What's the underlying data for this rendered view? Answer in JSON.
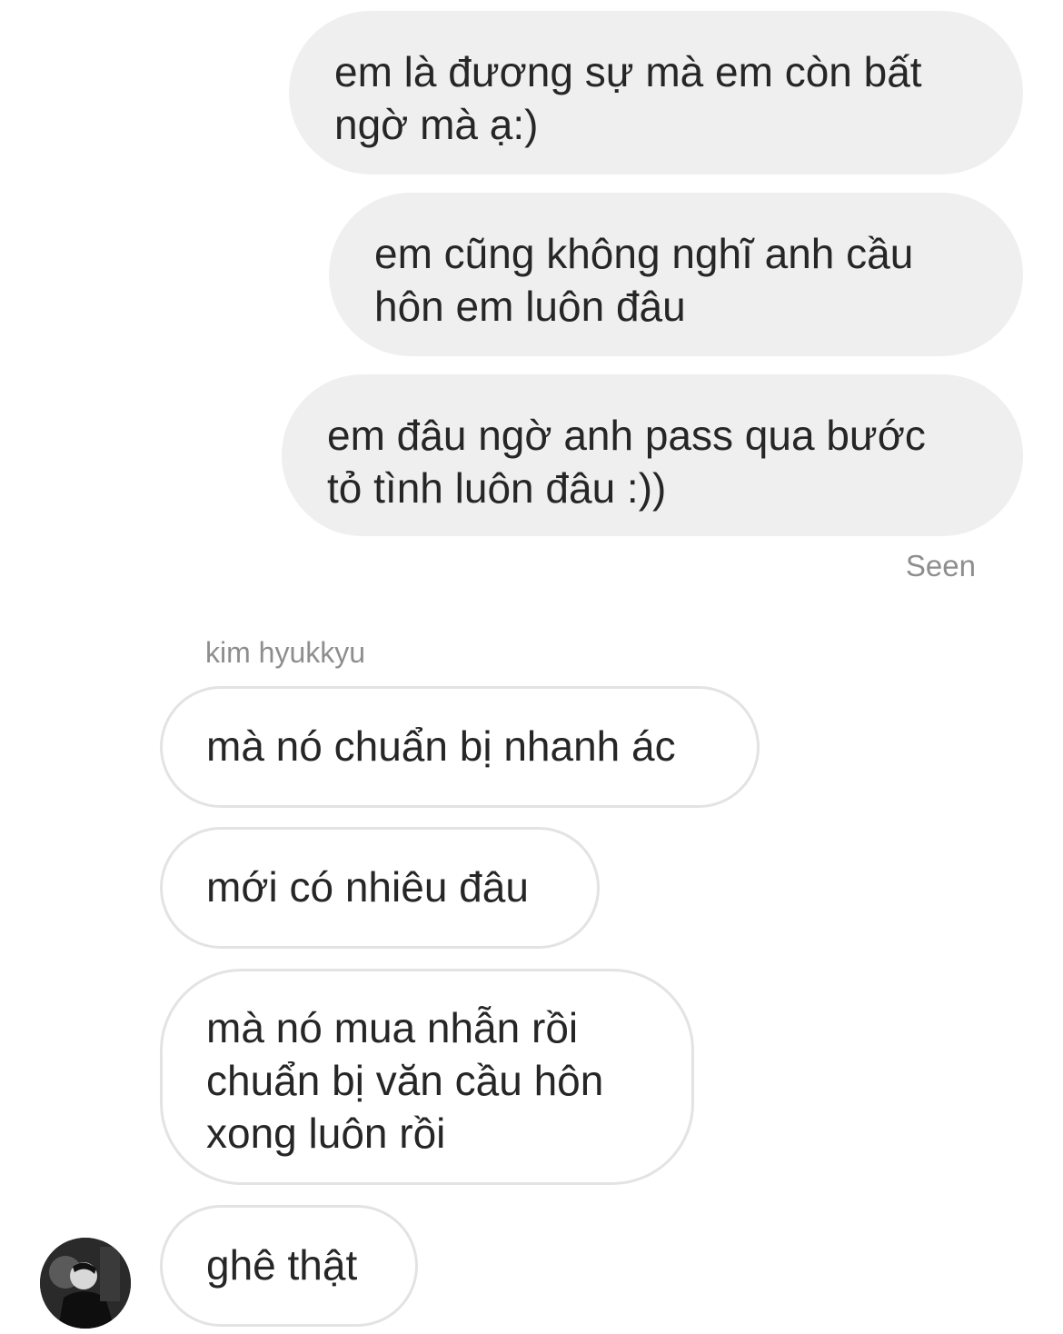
{
  "sent_messages": [
    {
      "lines": [
        "em là đương sự mà em còn bất",
        "ngờ mà ạ:)"
      ]
    },
    {
      "lines": [
        "em cũng không nghĩ anh cầu",
        "hôn em luôn đâu"
      ]
    },
    {
      "lines": [
        "em đâu ngờ anh pass qua bước",
        "tỏ tình luôn đâu :))"
      ]
    }
  ],
  "seen_label": "Seen",
  "sender_name": "kim hyukkyu",
  "received_messages": [
    {
      "lines": [
        "mà nó chuẩn bị nhanh ác"
      ]
    },
    {
      "lines": [
        "mới có nhiêu đâu"
      ]
    },
    {
      "lines": [
        "mà nó mua nhẫn rồi",
        "chuẩn bị văn cầu hôn",
        "xong luôn rồi"
      ]
    },
    {
      "lines": [
        "ghê thật"
      ]
    }
  ],
  "colors": {
    "sent_bubble": "#efefef",
    "received_border": "#e3e3e3",
    "text": "#262626",
    "meta_text": "#8e8e8e"
  }
}
